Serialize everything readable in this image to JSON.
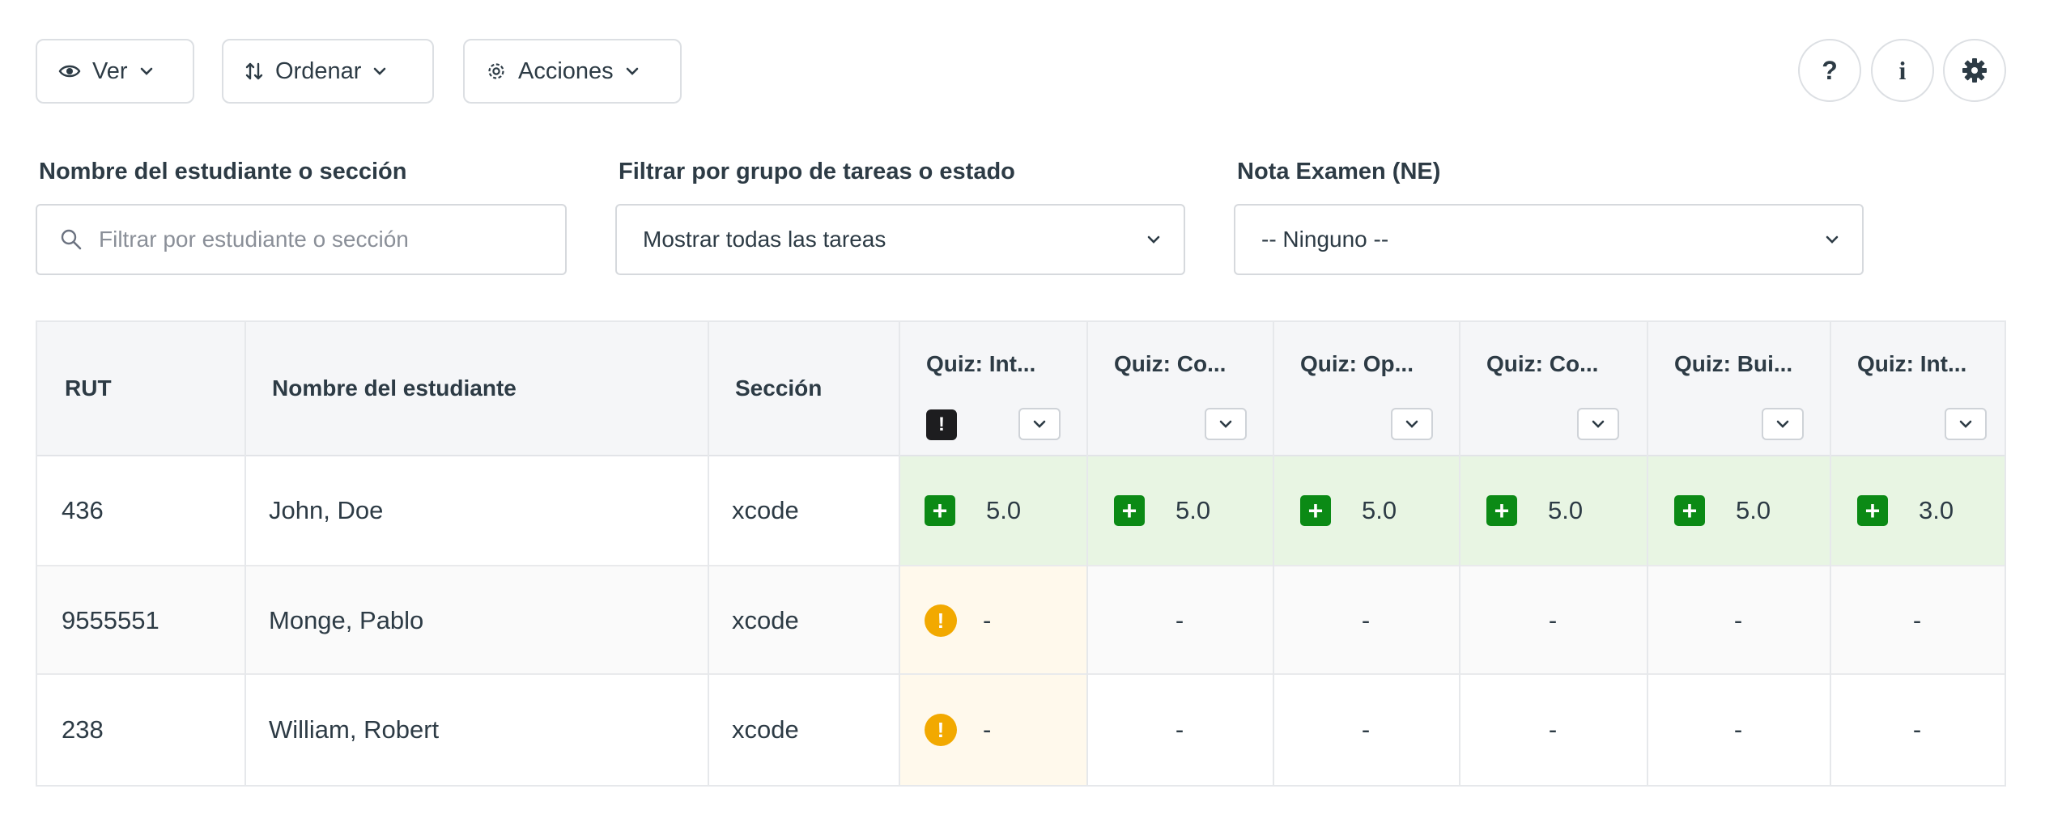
{
  "toolbar": {
    "ver_label": "Ver",
    "ordenar_label": "Ordenar",
    "acciones_label": "Acciones",
    "help_label": "?",
    "info_label": "i"
  },
  "filters": {
    "student_label": "Nombre del estudiante o sección",
    "student_placeholder": "Filtrar por estudiante o sección",
    "group_label": "Filtrar por grupo de tareas o estado",
    "group_value": "Mostrar todas las tareas",
    "exam_label": "Nota Examen (NE)",
    "exam_value": "-- Ninguno --"
  },
  "grid": {
    "headers": {
      "rut": "RUT",
      "name": "Nombre del estudiante",
      "section": "Sección",
      "assignments": [
        "Quiz: Int...",
        "Quiz: Co...",
        "Quiz: Op...",
        "Quiz: Co...",
        "Quiz: Bui...",
        "Quiz: Int..."
      ]
    },
    "rows": [
      {
        "rut": "436",
        "name": "John, Doe",
        "section": "xcode",
        "scores": [
          "5.0",
          "5.0",
          "5.0",
          "5.0",
          "5.0",
          "3.0"
        ]
      },
      {
        "rut": "9555551",
        "name": "Monge, Pablo",
        "section": "xcode",
        "scores": [
          "-",
          "-",
          "-",
          "-",
          "-",
          "-"
        ]
      },
      {
        "rut": "238",
        "name": "William, Robert",
        "section": "xcode",
        "scores": [
          "-",
          "-",
          "-",
          "-",
          "-",
          "-"
        ]
      }
    ],
    "header_alert": "!",
    "plus_symbol": "+",
    "warn_symbol": "!"
  },
  "colors": {
    "submitted_row_bg": "#e8f5e3",
    "pending_cell_bg": "#fff9ec",
    "plus_green": "#0b8a15",
    "warn_amber": "#f2a900"
  }
}
